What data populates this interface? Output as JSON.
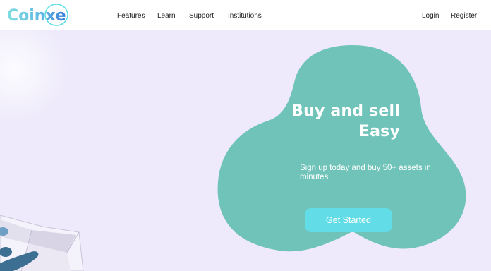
{
  "brand": {
    "logo_text": "Coinxe",
    "colors": {
      "primary_teal": "#6fc3b8",
      "accent_cyan": "#62dce7",
      "hero_bg": "#eeeafb",
      "logo_blue": "#3a7bd5"
    }
  },
  "nav": {
    "items": [
      {
        "label": "Features"
      },
      {
        "label": "Learn"
      },
      {
        "label": "Support"
      },
      {
        "label": "Institutions"
      }
    ],
    "login_label": "Login",
    "register_label": "Register"
  },
  "hero": {
    "title_line1": "Buy and sell",
    "title_line2": "Easy",
    "subtitle": "Sign up today and buy 50+ assets in minutes.",
    "cta_label": "Get Started"
  }
}
